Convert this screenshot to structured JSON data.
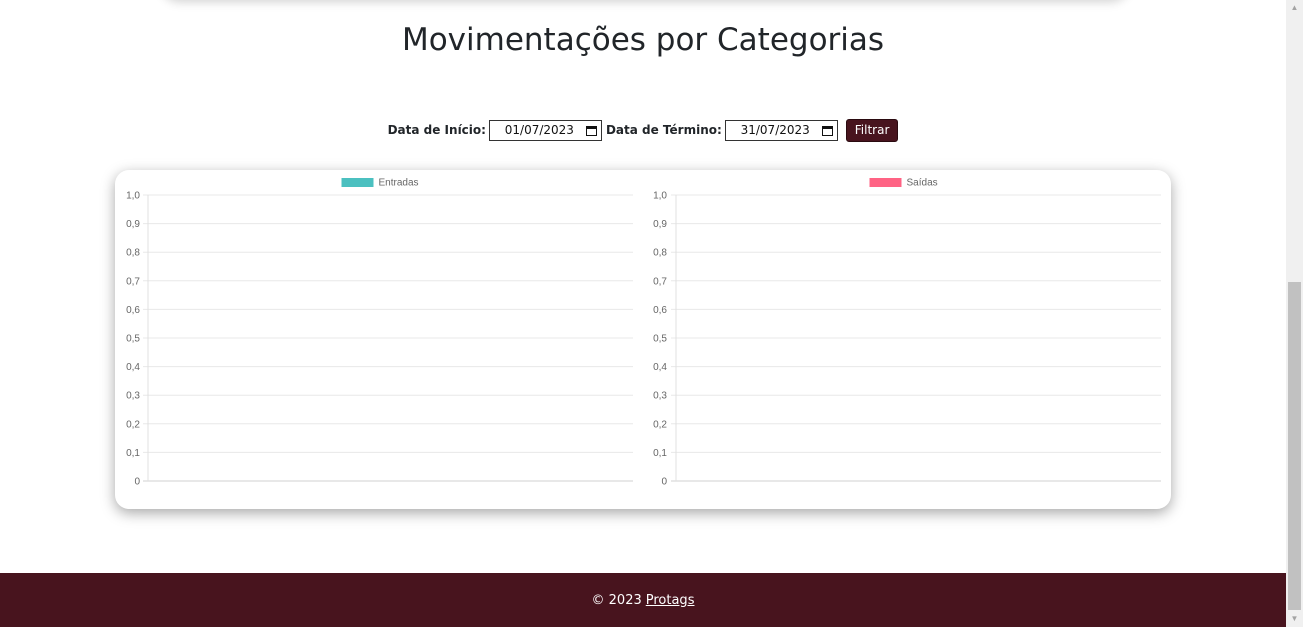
{
  "page": {
    "title": "Movimentações por Categorias"
  },
  "filter": {
    "start_label": "Data de Início:",
    "start_value": "01/07/2023",
    "end_label": "Data de Término:",
    "end_value": "31/07/2023",
    "button_label": "Filtrar"
  },
  "chart_data": [
    {
      "type": "bar",
      "legend": "Entradas",
      "series": [
        {
          "name": "Entradas",
          "values": []
        }
      ],
      "categories": [],
      "ylim": [
        0,
        1.0
      ],
      "yticks": [
        "0",
        "0,1",
        "0,2",
        "0,3",
        "0,4",
        "0,5",
        "0,6",
        "0,7",
        "0,8",
        "0,9",
        "1,0"
      ],
      "color": "#4bc0c0",
      "legend_position": "top",
      "grid": true
    },
    {
      "type": "bar",
      "legend": "Saídas",
      "series": [
        {
          "name": "Saídas",
          "values": []
        }
      ],
      "categories": [],
      "ylim": [
        0,
        1.0
      ],
      "yticks": [
        "0",
        "0,1",
        "0,2",
        "0,3",
        "0,4",
        "0,5",
        "0,6",
        "0,7",
        "0,8",
        "0,9",
        "1,0"
      ],
      "color": "#ff6384",
      "legend_position": "top",
      "grid": true
    }
  ],
  "footer": {
    "copyright": "© 2023",
    "link_label": "Protags"
  },
  "colors": {
    "brand": "#48141e",
    "entradas": "#4bc0c0",
    "saidas": "#ff6384"
  }
}
